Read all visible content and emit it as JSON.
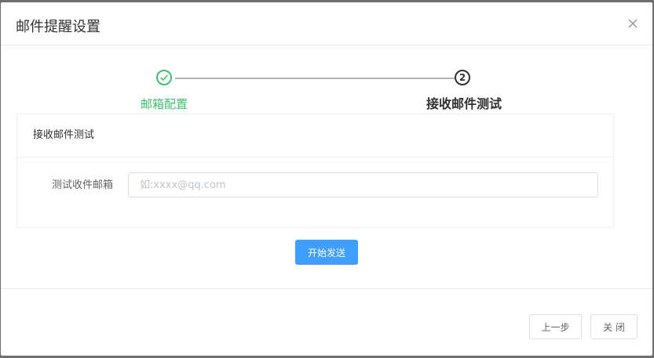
{
  "dialog": {
    "title": "邮件提醒设置"
  },
  "steps": [
    {
      "title": "邮箱配置",
      "status": "finished"
    },
    {
      "title": "接收邮件测试",
      "number": "2",
      "status": "process"
    }
  ],
  "card": {
    "title": "接收邮件测试",
    "form": {
      "label": "测试收件邮箱",
      "value": "",
      "placeholder": "如:xxxx@qq.com"
    }
  },
  "actions": {
    "send_label": "开始发送",
    "prev_label": "上一步",
    "close_label": "关 闭"
  },
  "colors": {
    "success": "#3fbf6e",
    "primary": "#409eff"
  }
}
